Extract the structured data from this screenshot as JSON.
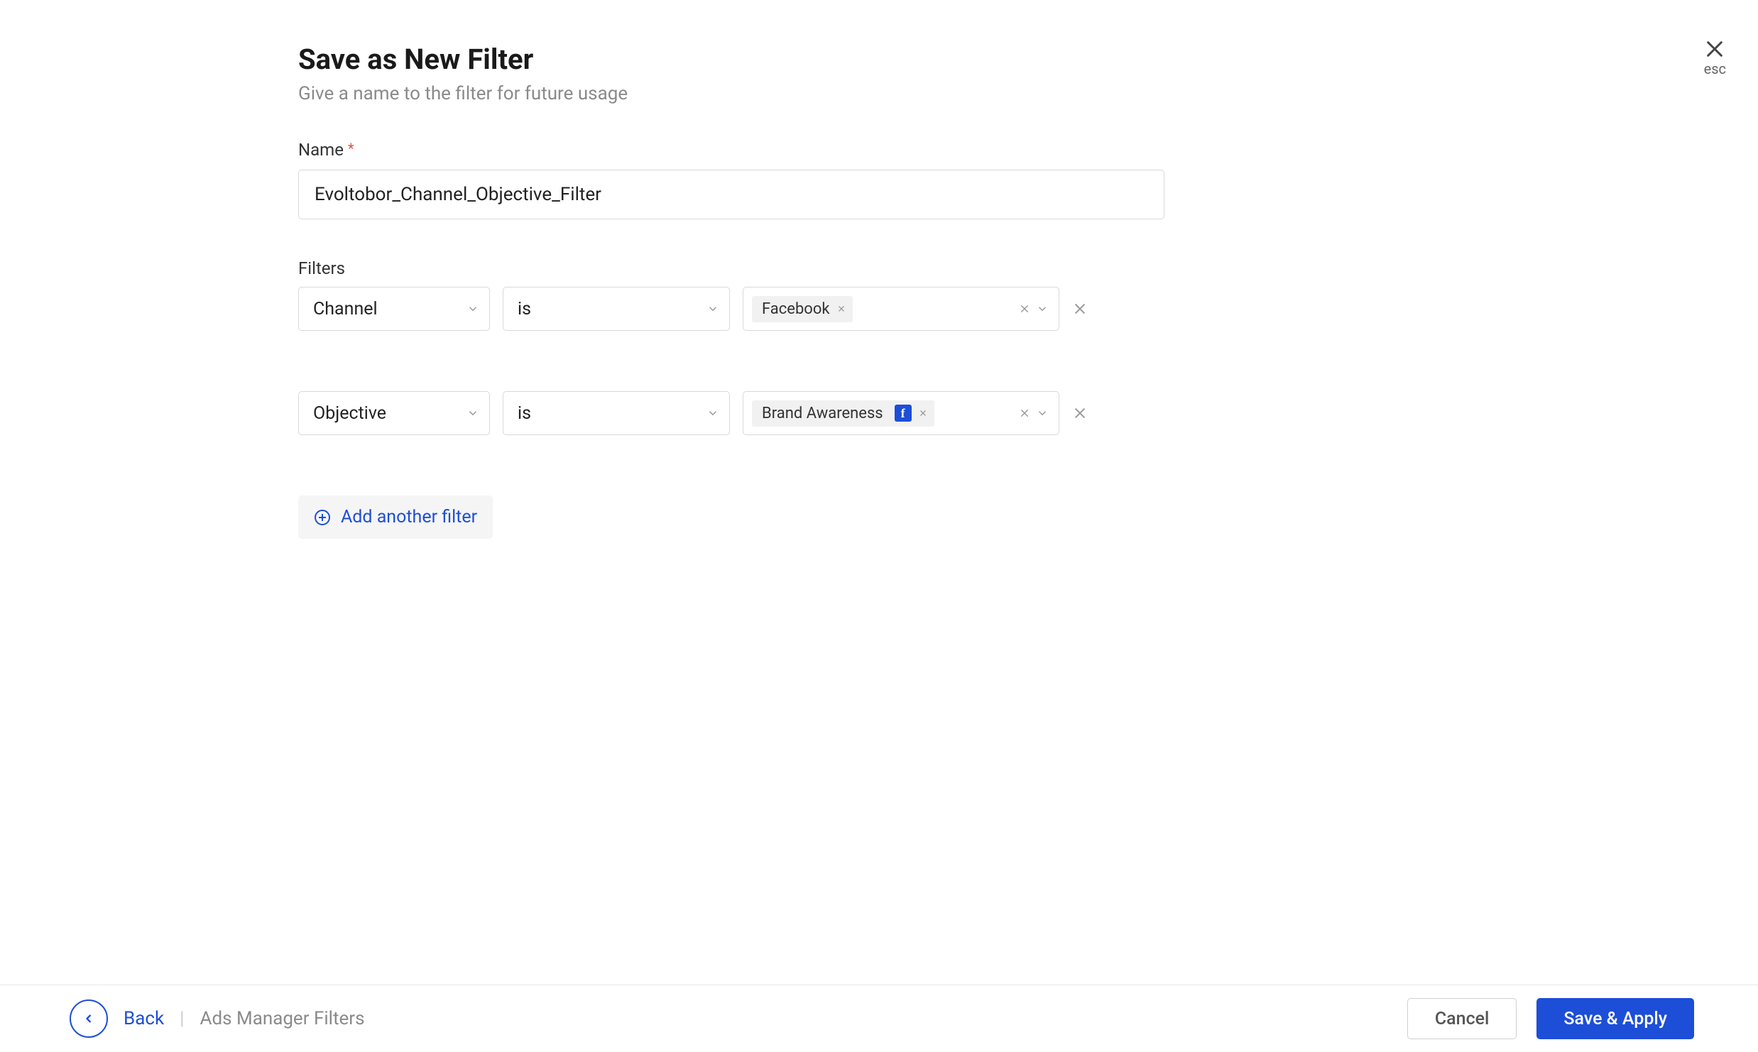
{
  "header": {
    "title": "Save as New Filter",
    "subtitle": "Give a name to the filter for future usage",
    "close_label": "esc"
  },
  "form": {
    "name_label": "Name",
    "name_value": "Evoltobor_Channel_Objective_Filter",
    "filters_label": "Filters"
  },
  "filters": [
    {
      "field": "Channel",
      "operator": "is",
      "value": "Facebook",
      "has_platform_icon": false
    },
    {
      "field": "Objective",
      "operator": "is",
      "value": "Brand Awareness",
      "has_platform_icon": true
    }
  ],
  "actions": {
    "add_another": "Add another filter"
  },
  "footer": {
    "back": "Back",
    "breadcrumb": "Ads Manager Filters",
    "cancel": "Cancel",
    "save": "Save & Apply"
  },
  "colors": {
    "primary": "#1d4ed8",
    "border": "#d9d9d9",
    "text_muted": "#8a8a8a"
  }
}
